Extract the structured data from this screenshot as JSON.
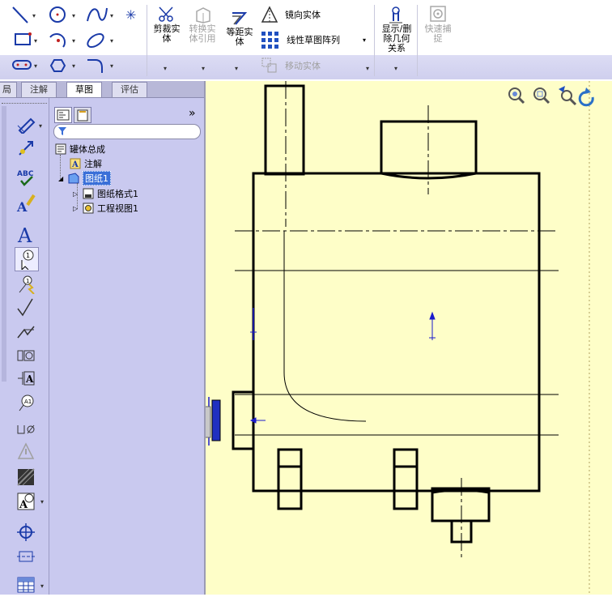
{
  "ribbon": {
    "trim_label": "剪裁实\n体",
    "convert_label": "转换实\n体引用",
    "offset_label": "等距实\n体",
    "mirror_label": "镜向实体",
    "linear_pattern_label": "线性草图阵列",
    "move_label": "移动实体",
    "relations_label": "显示/删\n除几何\n关系",
    "quick_snap_label": "快速捕\n捉"
  },
  "tabs": [
    {
      "label": "局",
      "active": false
    },
    {
      "label": "注解",
      "active": false
    },
    {
      "label": "草图",
      "active": true
    },
    {
      "label": "评估",
      "active": false
    }
  ],
  "feature_manager": {
    "expand_glyph": "»",
    "tree": [
      {
        "label": "罐体总成"
      },
      {
        "label": "注解"
      },
      {
        "label": "图纸1",
        "selected": true
      },
      {
        "label": "图纸格式1"
      },
      {
        "label": "工程视图1"
      }
    ]
  },
  "colors": {
    "canvas_bg": "#fefec8",
    "panel_bg": "#c9c9ef",
    "selection": "#3a6fd8",
    "sketch_blue": "#1a1acc"
  }
}
